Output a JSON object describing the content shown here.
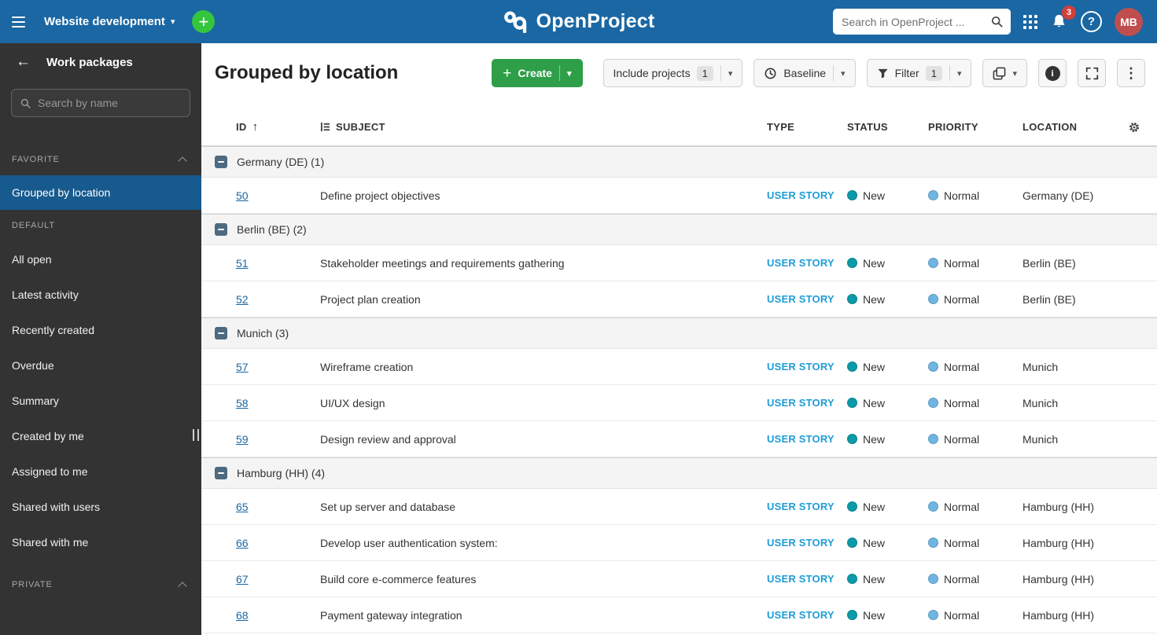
{
  "colors": {
    "header_blue": "#1a67a3",
    "sidebar_bg": "#333333",
    "selected_item_bg": "#175a8e",
    "create_green": "#2f9e49",
    "plus_green": "#35c53d",
    "badge_red": "#d43f3a",
    "avatar_bg": "#bf4e4e",
    "type_blue": "#1f9cd6",
    "status_teal": "#0b9aa8",
    "priority_blue": "#6fb5e2",
    "link_blue": "#1a67a3",
    "group_bg": "#f4f4f4"
  },
  "icons": {
    "caret_down": "▾",
    "sort_ascending": "↑",
    "kebab": "⋮",
    "plus": "+",
    "back_arrow": "←",
    "help": "?",
    "info": "i"
  },
  "topbar": {
    "project_name": "Website development",
    "logo_text": "OpenProject",
    "search_placeholder": "Search in OpenProject ...",
    "notification_count": "3",
    "avatar_initials": "MB"
  },
  "sidebar": {
    "title": "Work packages",
    "search_placeholder": "Search by name",
    "sections": [
      {
        "label": "FAVORITE",
        "items": [
          {
            "label": "Grouped by location"
          }
        ]
      },
      {
        "label": "DEFAULT",
        "items": [
          {
            "label": "All open"
          },
          {
            "label": "Latest activity"
          },
          {
            "label": "Recently created"
          },
          {
            "label": "Overdue"
          },
          {
            "label": "Summary"
          },
          {
            "label": "Created by me"
          },
          {
            "label": "Assigned to me"
          },
          {
            "label": "Shared with users"
          },
          {
            "label": "Shared with me"
          }
        ]
      },
      {
        "label": "PRIVATE",
        "items": []
      }
    ]
  },
  "main": {
    "page_title": "Grouped by location",
    "toolbar": {
      "create_label": "Create",
      "include_projects_label": "Include projects",
      "include_projects_count": "1",
      "baseline_label": "Baseline",
      "filter_label": "Filter",
      "filter_count": "1"
    },
    "table": {
      "headers": {
        "id": "ID",
        "subject": "SUBJECT",
        "type": "TYPE",
        "status": "STATUS",
        "priority": "PRIORITY",
        "location": "LOCATION"
      },
      "groups": [
        {
          "label": "Germany (DE) (1)",
          "rows": [
            {
              "id": "50",
              "subject": "Define project objectives",
              "type": "USER STORY",
              "status": "New",
              "priority": "Normal",
              "location": "Germany (DE)"
            }
          ]
        },
        {
          "label": "Berlin (BE) (2)",
          "rows": [
            {
              "id": "51",
              "subject": "Stakeholder meetings and requirements gathering",
              "type": "USER STORY",
              "status": "New",
              "priority": "Normal",
              "location": "Berlin (BE)"
            },
            {
              "id": "52",
              "subject": "Project plan creation",
              "type": "USER STORY",
              "status": "New",
              "priority": "Normal",
              "location": "Berlin (BE)"
            }
          ]
        },
        {
          "label": "Munich (3)",
          "rows": [
            {
              "id": "57",
              "subject": "Wireframe creation",
              "type": "USER STORY",
              "status": "New",
              "priority": "Normal",
              "location": "Munich"
            },
            {
              "id": "58",
              "subject": "UI/UX design",
              "type": "USER STORY",
              "status": "New",
              "priority": "Normal",
              "location": "Munich"
            },
            {
              "id": "59",
              "subject": "Design review and approval",
              "type": "USER STORY",
              "status": "New",
              "priority": "Normal",
              "location": "Munich"
            }
          ]
        },
        {
          "label": "Hamburg (HH) (4)",
          "rows": [
            {
              "id": "65",
              "subject": "Set up server and database",
              "type": "USER STORY",
              "status": "New",
              "priority": "Normal",
              "location": "Hamburg (HH)"
            },
            {
              "id": "66",
              "subject": "Develop user authentication system:",
              "type": "USER STORY",
              "status": "New",
              "priority": "Normal",
              "location": "Hamburg (HH)"
            },
            {
              "id": "67",
              "subject": "Build core e-commerce features",
              "type": "USER STORY",
              "status": "New",
              "priority": "Normal",
              "location": "Hamburg (HH)"
            },
            {
              "id": "68",
              "subject": "Payment gateway integration",
              "type": "USER STORY",
              "status": "New",
              "priority": "Normal",
              "location": "Hamburg (HH)"
            }
          ]
        }
      ]
    }
  }
}
